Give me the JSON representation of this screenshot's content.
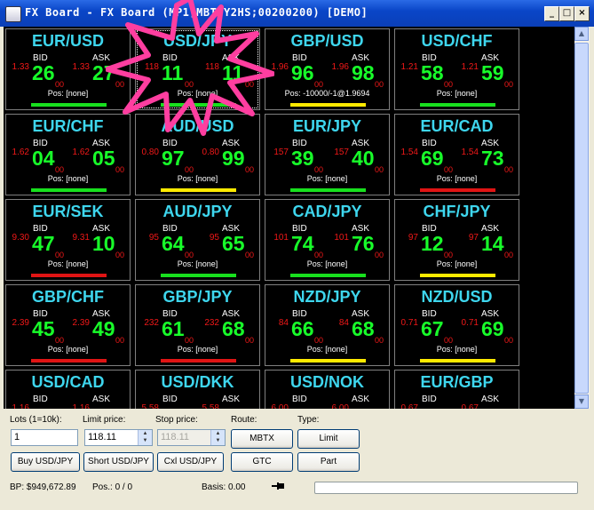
{
  "window": {
    "title": "FX Board - FX Board (MP1;MBT;Y2HS;00200200) [DEMO]"
  },
  "labels": {
    "bid": "BID",
    "ask": "ASK"
  },
  "colors": {
    "bar_green": "#18e01e",
    "bar_yellow": "#ffea00",
    "bar_red": "#e01414",
    "pair": "#3ed6ee",
    "price": "#18ff2a",
    "small": "#f01818"
  },
  "tiles": [
    {
      "pair": "EUR/USD",
      "bid_s": "1.33",
      "bid_b": "26",
      "bid_sub": "00",
      "ask_s": "1.33",
      "ask_b": "27",
      "ask_sub": "00",
      "pos": "Pos: [none]",
      "bar": "green"
    },
    {
      "pair": "USD/JPY",
      "bid_s": "118",
      "bid_b": "11",
      "bid_sub": "00",
      "ask_s": "118",
      "ask_b": "11",
      "ask_sub": "00",
      "pos": "Pos: [none]",
      "bar": "green",
      "selected": true
    },
    {
      "pair": "GBP/USD",
      "bid_s": "1.96",
      "bid_b": "96",
      "bid_sub": "00",
      "ask_s": "1.96",
      "ask_b": "98",
      "ask_sub": "00",
      "pos": "Pos: -10000/-1@1.9694",
      "bar": "yellow"
    },
    {
      "pair": "USD/CHF",
      "bid_s": "1.21",
      "bid_b": "58",
      "bid_sub": "00",
      "ask_s": "1.21",
      "ask_b": "59",
      "ask_sub": "00",
      "pos": "Pos: [none]",
      "bar": "green"
    },
    {
      "pair": "EUR/CHF",
      "bid_s": "1.62",
      "bid_b": "04",
      "bid_sub": "00",
      "ask_s": "1.62",
      "ask_b": "05",
      "ask_sub": "00",
      "pos": "Pos: [none]",
      "bar": "green"
    },
    {
      "pair": "AUD/USD",
      "bid_s": "0.80",
      "bid_b": "97",
      "bid_sub": "00",
      "ask_s": "0.80",
      "ask_b": "99",
      "ask_sub": "00",
      "pos": "Pos: [none]",
      "bar": "yellow"
    },
    {
      "pair": "EUR/JPY",
      "bid_s": "157",
      "bid_b": "39",
      "bid_sub": "00",
      "ask_s": "157",
      "ask_b": "40",
      "ask_sub": "00",
      "pos": "Pos: [none]",
      "bar": "green"
    },
    {
      "pair": "EUR/CAD",
      "bid_s": "1.54",
      "bid_b": "69",
      "bid_sub": "00",
      "ask_s": "1.54",
      "ask_b": "73",
      "ask_sub": "00",
      "pos": "Pos: [none]",
      "bar": "red"
    },
    {
      "pair": "EUR/SEK",
      "bid_s": "9.30",
      "bid_b": "47",
      "bid_sub": "00",
      "ask_s": "9.31",
      "ask_b": "10",
      "ask_sub": "00",
      "pos": "Pos: [none]",
      "bar": "red"
    },
    {
      "pair": "AUD/JPY",
      "bid_s": "95",
      "bid_b": "64",
      "bid_sub": "00",
      "ask_s": "95",
      "ask_b": "65",
      "ask_sub": "00",
      "pos": "Pos: [none]",
      "bar": "green"
    },
    {
      "pair": "CAD/JPY",
      "bid_s": "101",
      "bid_b": "74",
      "bid_sub": "00",
      "ask_s": "101",
      "ask_b": "76",
      "ask_sub": "00",
      "pos": "Pos: [none]",
      "bar": "green"
    },
    {
      "pair": "CHF/JPY",
      "bid_s": "97",
      "bid_b": "12",
      "bid_sub": "00",
      "ask_s": "97",
      "ask_b": "14",
      "ask_sub": "00",
      "pos": "Pos: [none]",
      "bar": "yellow"
    },
    {
      "pair": "GBP/CHF",
      "bid_s": "2.39",
      "bid_b": "45",
      "bid_sub": "00",
      "ask_s": "2.39",
      "ask_b": "49",
      "ask_sub": "00",
      "pos": "Pos: [none]",
      "bar": "red"
    },
    {
      "pair": "GBP/JPY",
      "bid_s": "232",
      "bid_b": "61",
      "bid_sub": "00",
      "ask_s": "232",
      "ask_b": "68",
      "ask_sub": "00",
      "pos": "Pos: [none]",
      "bar": "red"
    },
    {
      "pair": "NZD/JPY",
      "bid_s": "84",
      "bid_b": "66",
      "bid_sub": "00",
      "ask_s": "84",
      "ask_b": "68",
      "ask_sub": "00",
      "pos": "Pos: [none]",
      "bar": "yellow"
    },
    {
      "pair": "NZD/USD",
      "bid_s": "0.71",
      "bid_b": "67",
      "bid_sub": "00",
      "ask_s": "0.71",
      "ask_b": "69",
      "ask_sub": "00",
      "pos": "Pos: [none]",
      "bar": "yellow"
    },
    {
      "pair": "USD/CAD",
      "bid_s": "1.16",
      "bid_b": "",
      "bid_sub": "",
      "ask_s": "1.16",
      "ask_b": "",
      "ask_sub": "",
      "pos": "",
      "bar": ""
    },
    {
      "pair": "USD/DKK",
      "bid_s": "5.58",
      "bid_b": "",
      "bid_sub": "",
      "ask_s": "5.58",
      "ask_b": "",
      "ask_sub": "",
      "pos": "",
      "bar": ""
    },
    {
      "pair": "USD/NOK",
      "bid_s": "6.00",
      "bid_b": "",
      "bid_sub": "",
      "ask_s": "6.00",
      "ask_b": "",
      "ask_sub": "",
      "pos": "",
      "bar": ""
    },
    {
      "pair": "EUR/GBP",
      "bid_s": "0.67",
      "bid_b": "",
      "bid_sub": "",
      "ask_s": "0.67",
      "ask_b": "",
      "ask_sub": "",
      "pos": "",
      "bar": ""
    }
  ],
  "panel": {
    "lots_label": "Lots (1=10k):",
    "lots_value": "1",
    "limit_label": "Limit price:",
    "limit_value": "118.11",
    "stop_label": "Stop price:",
    "stop_value": "118.11",
    "route_label": "Route:",
    "type_label": "Type:",
    "buy_btn": "Buy USD/JPY",
    "short_btn": "Short USD/JPY",
    "cxl_btn": "Cxl USD/JPY",
    "mbtx_btn": "MBTX",
    "gtc_btn": "GTC",
    "limit_btn": "Limit",
    "part_btn": "Part"
  },
  "status": {
    "bp": "BP: $949,672.89",
    "pos": "Pos.: 0 / 0",
    "basis": "Basis: 0.00"
  }
}
